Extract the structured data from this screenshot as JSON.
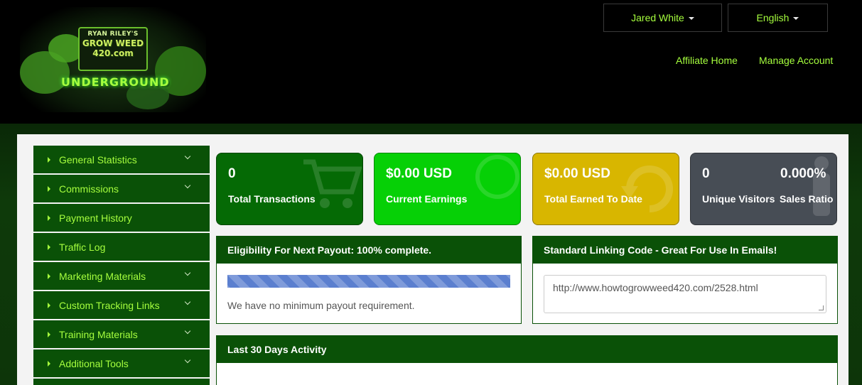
{
  "header": {
    "logo": {
      "line1": "RYAN RILEY'S",
      "line2": "GROW WEED",
      "line3": "420.com",
      "line4": "UNDERGROUND"
    },
    "user_button": "Jared White",
    "language_button": "English",
    "links": {
      "affiliate_home": "Affiliate Home",
      "manage_account": "Manage Account"
    }
  },
  "sidebar": {
    "items": [
      {
        "label": "General Statistics",
        "expandable": true
      },
      {
        "label": "Commissions",
        "expandable": true
      },
      {
        "label": "Payment History",
        "expandable": false
      },
      {
        "label": "Traffic Log",
        "expandable": false
      },
      {
        "label": "Marketing Materials",
        "expandable": true
      },
      {
        "label": "Custom Tracking Links",
        "expandable": true
      },
      {
        "label": "Training Materials",
        "expandable": true
      },
      {
        "label": "Additional Tools",
        "expandable": true
      }
    ]
  },
  "stats": {
    "transactions": {
      "value": "0",
      "label": "Total Transactions",
      "icon": "cart-icon",
      "color": "#056a05"
    },
    "current_earnings": {
      "value": "$0.00 USD",
      "label": "Current Earnings",
      "icon": "dollar-icon",
      "color": "#06d006"
    },
    "total_earned": {
      "value": "$0.00 USD",
      "label": "Total Earned To Date",
      "icon": "refresh-icon",
      "color": "#d8b600"
    },
    "visitors": {
      "value": "0",
      "label": "Unique Visitors",
      "icon": "user-icon",
      "color": "#474d55"
    },
    "sales_ratio": {
      "value": "0.000%",
      "label": "Sales Ratio"
    }
  },
  "eligibility": {
    "title": "Eligibility For Next Payout: 100% complete.",
    "progress_percent": 100,
    "note": "We have no minimum payout requirement."
  },
  "linking_code": {
    "title": "Standard Linking Code - Great For Use In Emails!",
    "value": "http://www.howtogrowweed420.com/2528.html"
  },
  "activity": {
    "title": "Last 30 Days Activity"
  },
  "colors": {
    "accent_green": "#a6ff3e",
    "dark_green": "#0a5107"
  }
}
